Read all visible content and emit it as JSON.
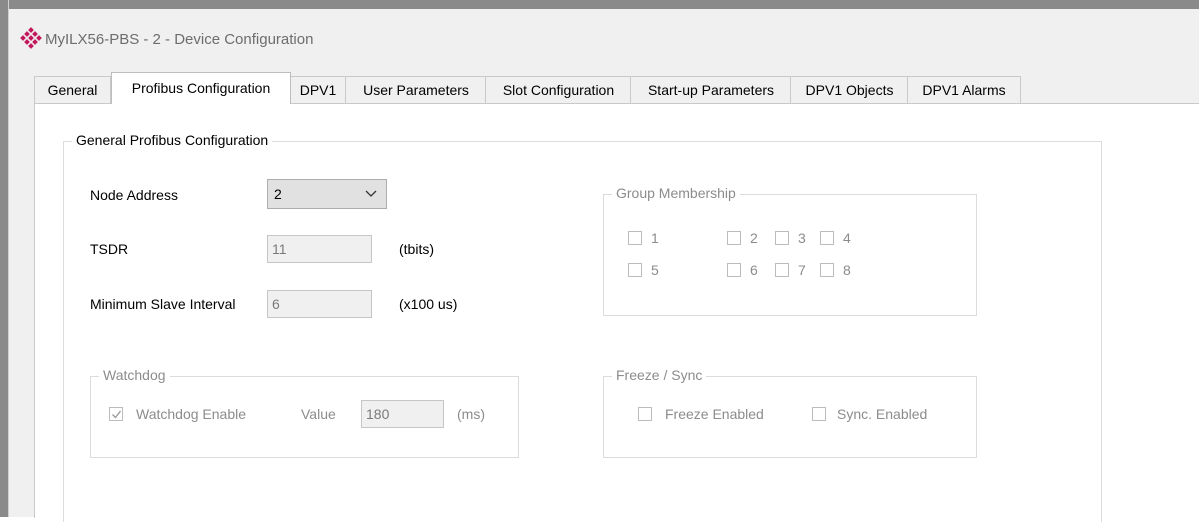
{
  "window": {
    "title": "MyILX56-PBS - 2 - Device Configuration",
    "icon": "prosoft-logo-icon"
  },
  "tabs": [
    {
      "label": "General",
      "active": false
    },
    {
      "label": "Profibus Configuration",
      "active": true
    },
    {
      "label": "DPV1",
      "active": false
    },
    {
      "label": "User Parameters",
      "active": false
    },
    {
      "label": "Slot Configuration",
      "active": false
    },
    {
      "label": "Start-up Parameters",
      "active": false
    },
    {
      "label": "DPV1 Objects",
      "active": false
    },
    {
      "label": "DPV1 Alarms",
      "active": false
    }
  ],
  "general": {
    "title": "General Profibus Configuration",
    "node_address": {
      "label": "Node Address",
      "value": "2"
    },
    "tsdr": {
      "label": "TSDR",
      "value": "11",
      "unit": "(tbits)"
    },
    "min_slave_interval": {
      "label": "Minimum Slave Interval",
      "value": "6",
      "unit": "(x100 us)"
    }
  },
  "group_membership": {
    "title": "Group Membership",
    "items": [
      {
        "label": "1",
        "checked": false
      },
      {
        "label": "2",
        "checked": false
      },
      {
        "label": "3",
        "checked": false
      },
      {
        "label": "4",
        "checked": false
      },
      {
        "label": "5",
        "checked": false
      },
      {
        "label": "6",
        "checked": false
      },
      {
        "label": "7",
        "checked": false
      },
      {
        "label": "8",
        "checked": false
      }
    ]
  },
  "watchdog": {
    "title": "Watchdog",
    "enable_label": "Watchdog Enable",
    "enabled": true,
    "value_label": "Value",
    "value": "180",
    "unit": "(ms)"
  },
  "freeze_sync": {
    "title": "Freeze / Sync",
    "freeze_label": "Freeze Enabled",
    "freeze_checked": false,
    "sync_label": "Sync. Enabled",
    "sync_checked": false
  },
  "colors": {
    "window_bg": "#f0f0f0",
    "panel_bg": "#ffffff",
    "disabled_text": "#8c8c8c",
    "logo": "#c2185b"
  }
}
